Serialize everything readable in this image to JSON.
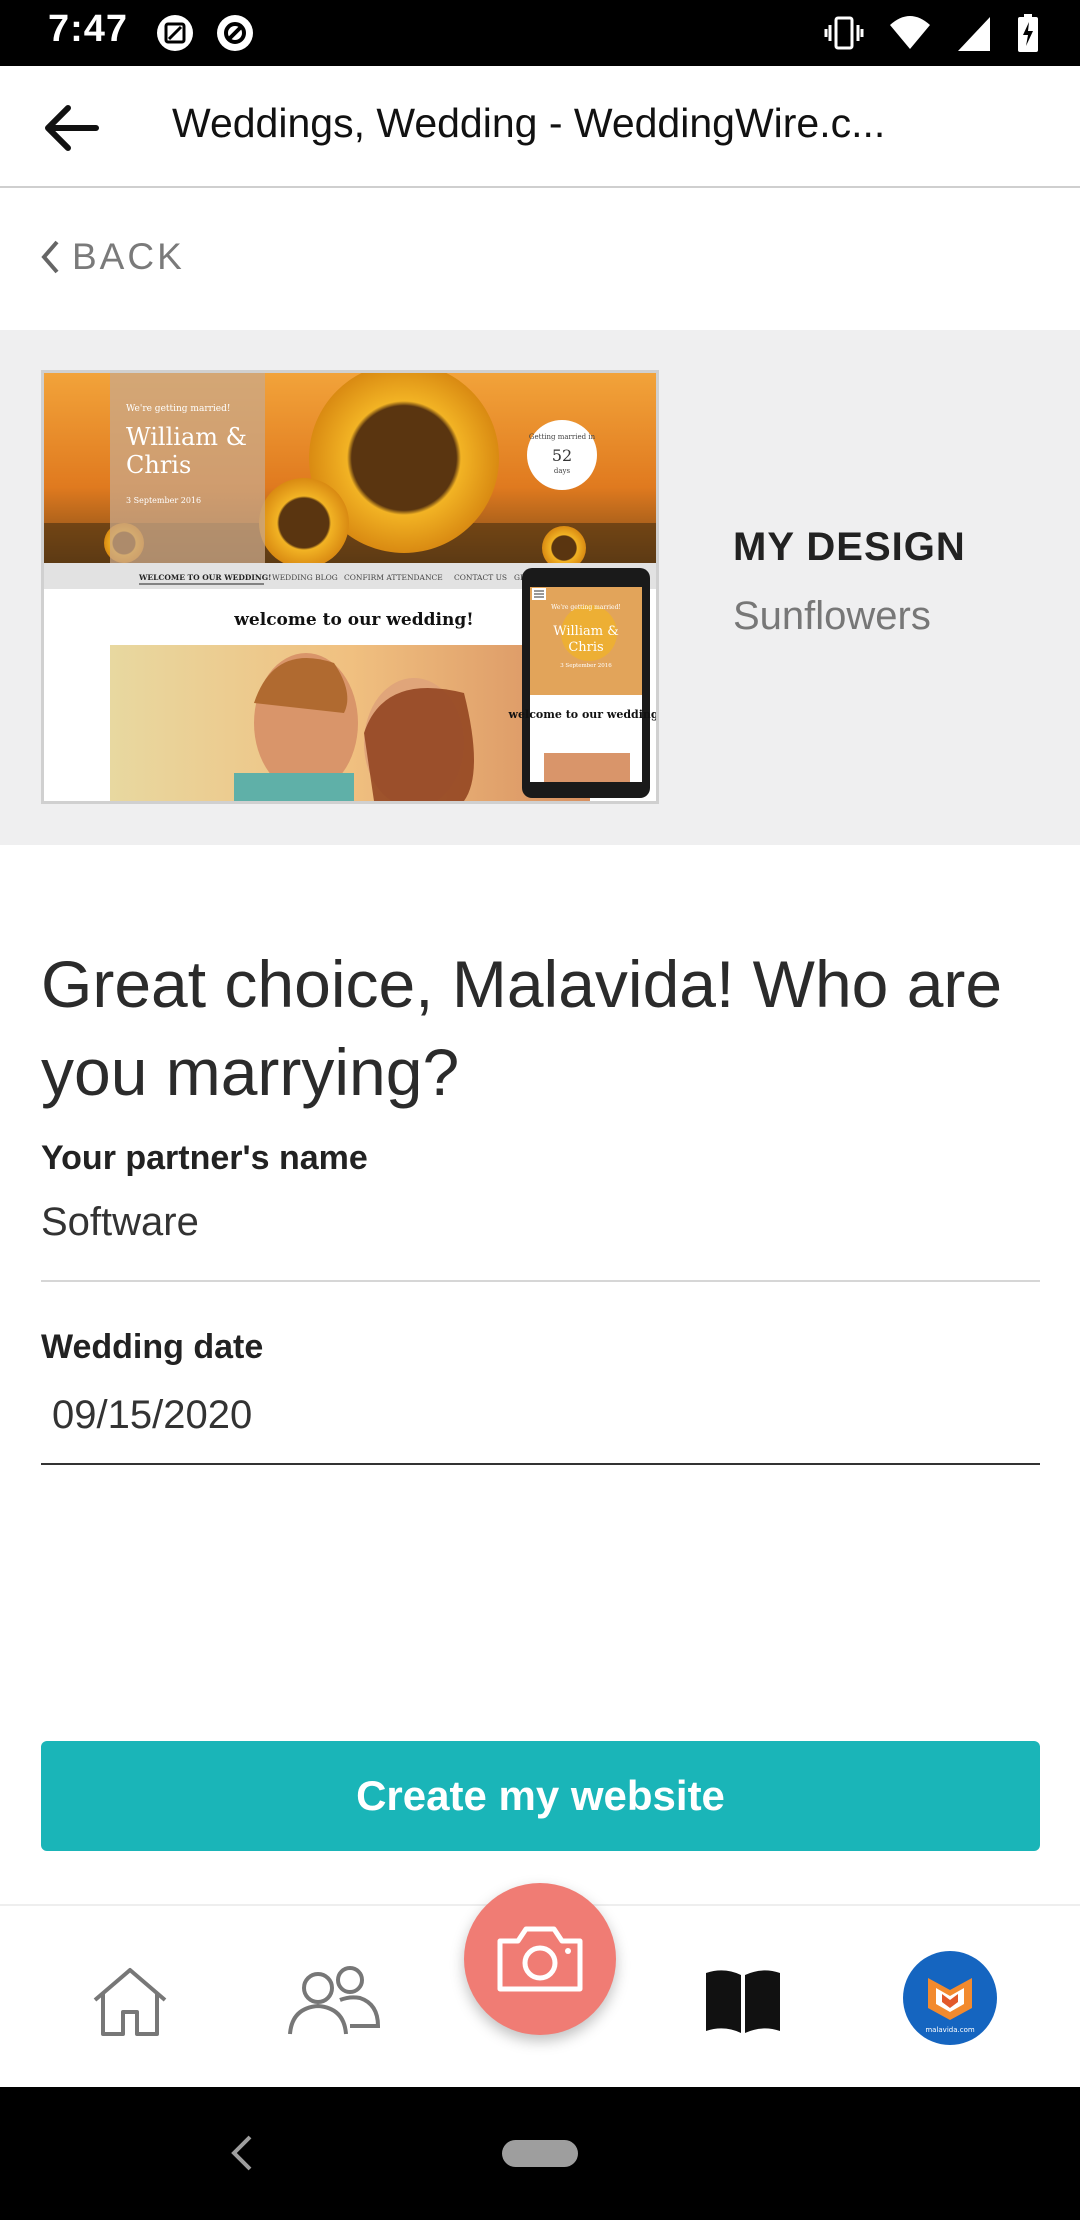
{
  "status_bar": {
    "time": "7:47",
    "left_icons": [
      "screenshot-icon",
      "data-saver-icon"
    ],
    "right_icons": [
      "vibrate-icon",
      "wifi-icon",
      "signal-icon",
      "battery-charging-icon"
    ]
  },
  "app_bar": {
    "title": "Weddings, Wedding - WeddingWire.c..."
  },
  "back_link": {
    "label": "BACK"
  },
  "design": {
    "label": "MY DESIGN",
    "name": "Sunflowers",
    "preview": {
      "tagline": "We're getting married!",
      "couple_line1": "William &",
      "couple_line2": "Chris",
      "date": "3 September 2016",
      "countdown_label": "Getting married in",
      "countdown_value": "52",
      "countdown_unit": "days",
      "nav_items": [
        "WELCOME TO OUR WEDDING!",
        "WEDDING BLOG",
        "CONFIRM ATTENDANCE",
        "CONTACT US",
        "GI"
      ],
      "welcome_heading": "welcome to our wedding!",
      "mobile_tagline": "We're getting married!",
      "mobile_couple_line1": "William &",
      "mobile_couple_line2": "Chris",
      "mobile_date": "3 September 2016",
      "mobile_welcome": "welcome to our wedding!"
    }
  },
  "form": {
    "headline": "Great choice, Malavida! Who are you marrying?",
    "partner_label": "Your partner's name",
    "partner_value": "Software",
    "date_label": "Wedding date",
    "date_value": "09/15/2020"
  },
  "cta": {
    "label": "Create my website"
  },
  "bottom_nav": {
    "items": [
      "home-icon",
      "guests-icon",
      "camera-icon",
      "book-icon",
      "profile-avatar"
    ],
    "avatar_caption": "malavida.com"
  },
  "colors": {
    "accent": "#1ab5b8",
    "camera_fab": "#f07c74",
    "avatar_bg": "#1565c0",
    "band_bg": "#efeff0"
  }
}
